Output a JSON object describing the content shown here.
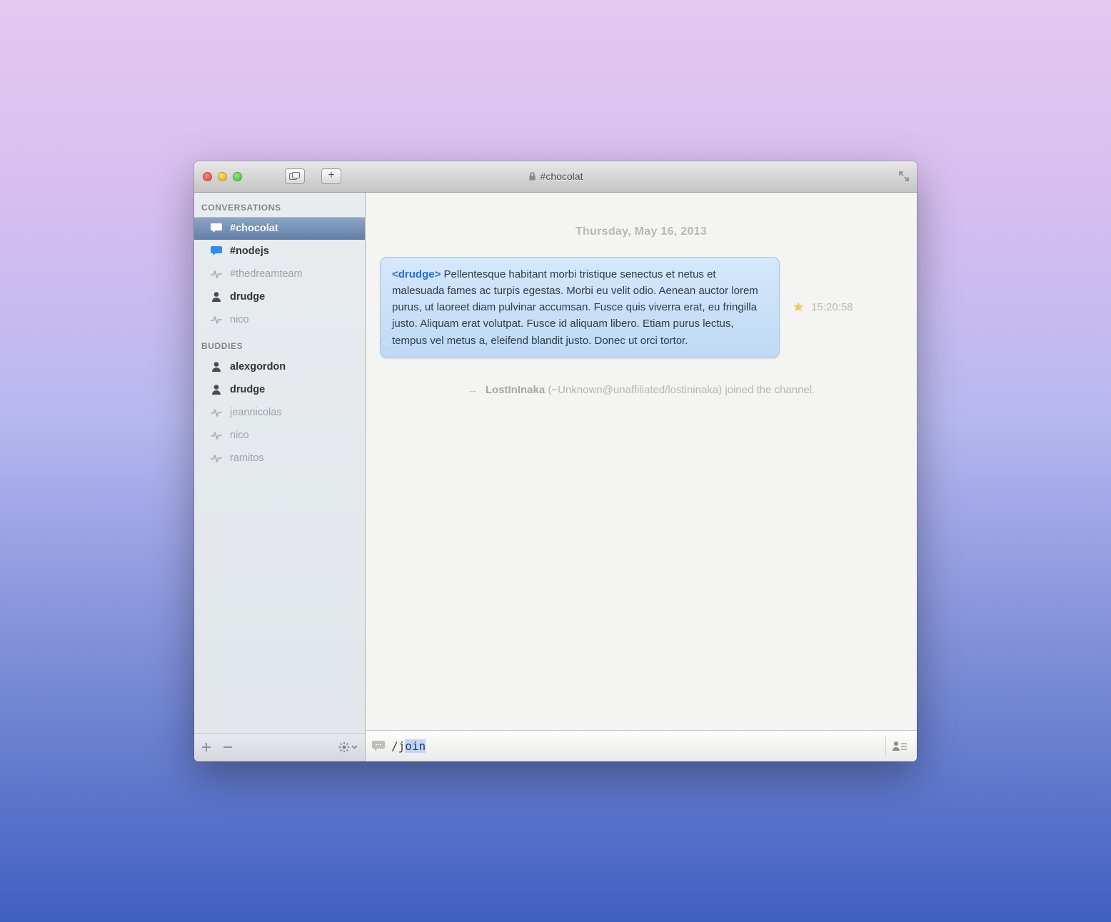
{
  "window": {
    "title": "#chocolat"
  },
  "sidebar": {
    "sections": {
      "conversations_title": "CONVERSATIONS",
      "buddies_title": "BUDDIES"
    },
    "conversations": [
      {
        "label": "#chocolat",
        "icon": "chat",
        "state": "selected"
      },
      {
        "label": "#nodejs",
        "icon": "chat-b",
        "state": "bold"
      },
      {
        "label": "#thedreamteam",
        "icon": "pulse",
        "state": "offline"
      },
      {
        "label": "drudge",
        "icon": "person",
        "state": "bold"
      },
      {
        "label": "nico",
        "icon": "pulse",
        "state": "offline"
      }
    ],
    "buddies": [
      {
        "label": "alexgordon",
        "icon": "person",
        "state": "bold"
      },
      {
        "label": "drudge",
        "icon": "person",
        "state": "bold"
      },
      {
        "label": "jeannicolas",
        "icon": "pulse",
        "state": "offline"
      },
      {
        "label": "nico",
        "icon": "pulse",
        "state": "offline"
      },
      {
        "label": "ramitos",
        "icon": "pulse",
        "state": "offline"
      }
    ]
  },
  "chat": {
    "date": "Thursday, May 16, 2013",
    "message": {
      "author": "<drudge>",
      "body": "Pellentesque habitant morbi tristique senectus et netus et malesuada fames ac turpis egestas. Morbi eu velit odio. Aenean auctor lorem purus, ut laoreet diam pulvinar accumsan. Fusce quis viverra erat, eu fringilla justo. Aliquam erat volutpat. Fusce id aliquam libero. Etiam purus lectus, tempus vel metus a, eleifend blandit justo. Donec ut orci tortor.",
      "time": "15:20:58"
    },
    "system": {
      "arrow": "→",
      "who": "LostInInaka",
      "rest": " (~Unknown@unaffiliated/lostininaka) joined the channel."
    }
  },
  "input": {
    "prefix": "/j",
    "selection": "oin"
  }
}
